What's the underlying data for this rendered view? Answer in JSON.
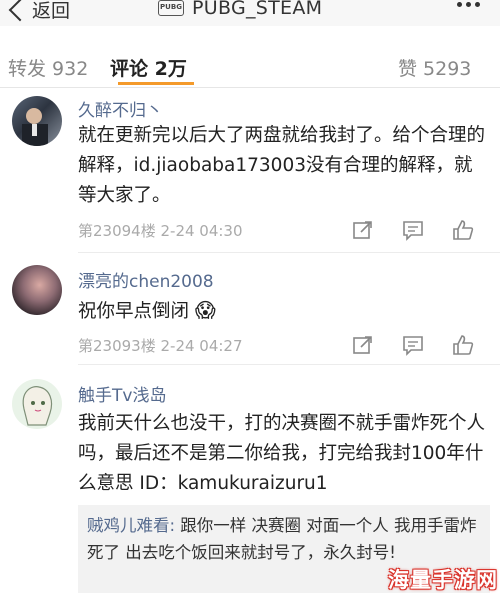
{
  "nav": {
    "back_label": "返回",
    "logo_text": "PUBG",
    "title": "PUBG_STEAM"
  },
  "tabs": {
    "repost": "转发 932",
    "comment": "评论 2万",
    "like": "赞 5293"
  },
  "comments": [
    {
      "username": "久醉不归丶",
      "text": "就在更新完以后大了两盘就给我封了。给个合理的解释，id.jiaobaba173003没有合理的解释，就等大家了。",
      "meta": "第23094楼 2-24 04:30"
    },
    {
      "username": "漂亮的chen2008",
      "text": "祝你早点倒闭",
      "emoji": "😱",
      "meta": "第23093楼 2-24 04:27"
    },
    {
      "username": "触手Tv浅岛",
      "text": "我前天什么也没干，打的决赛圈不就手雷炸死个人吗，最后还不是第二你给我，打完给我封100年什么意思 ID：kamukuraizuru1"
    }
  ],
  "reply": {
    "name": "贼鸡儿难看:",
    "text": " 跟你一样 决赛圈 对面一个人 我用手雷炸死了 出去吃个饭回来就封号了，永久封号!"
  },
  "watermark": "海量手游网",
  "colors": {
    "username": "#556a8e",
    "tab_active_underline": "#f49a2b",
    "meta": "#aaaaaa",
    "watermark_outline": "#d9322a"
  },
  "icons": [
    "chevron-left-icon",
    "pubg-logo-icon",
    "more-icon",
    "repost-icon",
    "comment-icon",
    "like-icon"
  ]
}
